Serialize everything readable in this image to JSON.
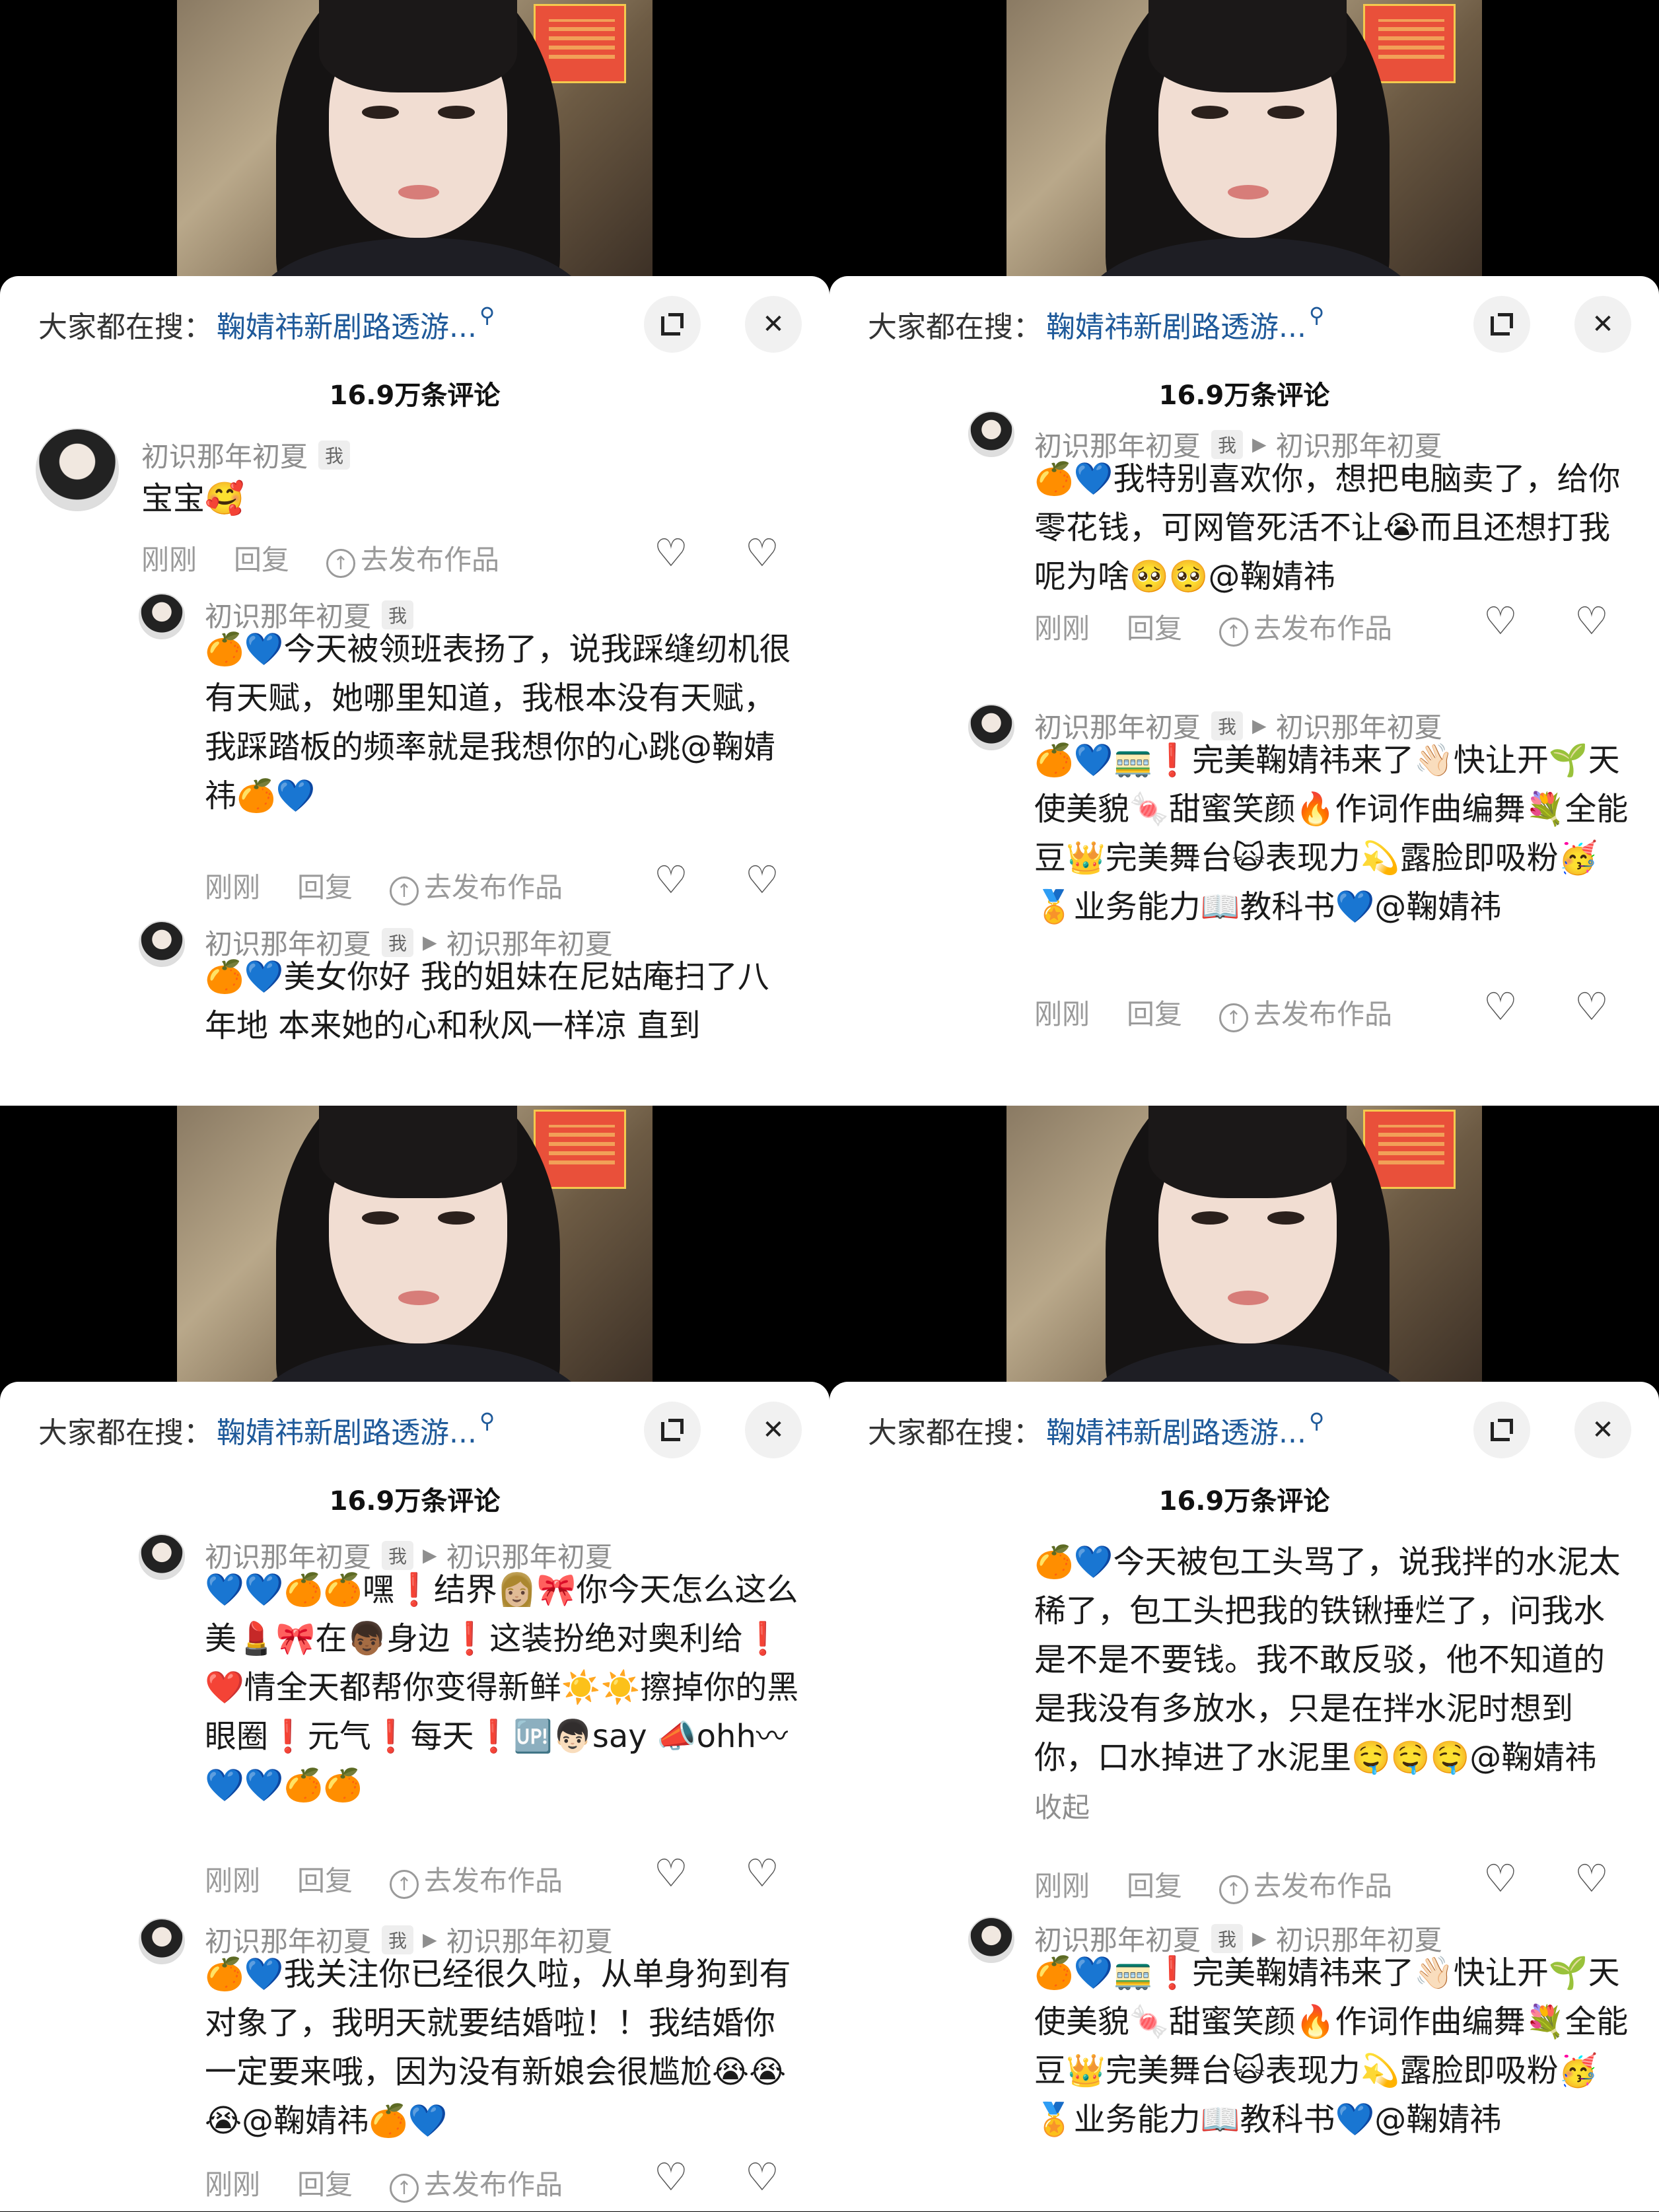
{
  "header": {
    "search_prefix": "大家都在搜：",
    "search_query": "鞠婧祎新剧路透游...",
    "comment_count": "16.9万条评论"
  },
  "icons": {
    "expand": "expand-icon",
    "close": "close-icon",
    "like": "heart-icon",
    "dislike": "broken-heart-icon",
    "upload": "upload-icon"
  },
  "actions": {
    "time": "刚刚",
    "reply": "回复",
    "publish": "去发布作品",
    "collapse": "收起"
  },
  "user": {
    "name": "初识那年初夏",
    "badge": "我",
    "reply_to": "初识那年初夏"
  },
  "quads": [
    {
      "comments": [
        {
          "body": "宝宝🥰"
        },
        {
          "body": "🍊💙今天被领班表扬了，说我踩缝纫机很有天赋，她哪里知道，我根本没有天赋，我踩踏板的频率就是我想你的心跳@鞠婧祎🍊💙"
        },
        {
          "body": "🍊💙美女你好 我的姐妹在尼姑庵扫了八年地 本来她的心和秋风一样凉 直到"
        }
      ]
    },
    {
      "comments": [
        {
          "body": "🍊💙我特别喜欢你，想把电脑卖了，给你零花钱，可网管死活不让😭而且还想打我呢为啥🥺🥺@鞠婧祎"
        },
        {
          "body": "🍊💙🚃❗完美鞠婧祎来了👋🏻快让开🌱天使美貌🍬甜蜜笑颜🔥作词作曲编舞💐全能豆👑完美舞台🙀表现力💫露脸即吸粉🥳🏅业务能力📖教科书💙@鞠婧祎"
        }
      ]
    },
    {
      "comments": [
        {
          "body": "💙💙🍊🍊嘿❗结界👩🏼🎀你今天怎么这么美💄🎀在👦🏾身边❗这装扮绝对奥利给❗❤️情全天都帮你变得新鲜☀️☀️擦掉你的黑眼圈❗元气❗每天❗🆙👦🏻say 📣ohh〰💙💙🍊🍊"
        },
        {
          "body": "🍊💙我关注你已经很久啦，从单身狗到有对象了，我明天就要结婚啦！！我结婚你一定要来哦，因为没有新娘会很尴尬😭😭😭@鞠婧祎🍊💙"
        }
      ]
    },
    {
      "comments": [
        {
          "body": "🍊💙今天被包工头骂了，说我拌的水泥太稀了，包工头把我的铁锹捶烂了，问我水是不是不要钱。我不敢反驳，他不知道的是我没有多放水，只是在拌水泥时想到你，口水掉进了水泥里🤤🤤🤤@鞠婧祎"
        },
        {
          "body": "🍊💙🚃❗完美鞠婧祎来了👋🏻快让开🌱天使美貌🍬甜蜜笑颜🔥作词作曲编舞💐全能豆👑完美舞台🙀表现力💫露脸即吸粉🥳🏅业务能力📖教科书💙@鞠婧祎"
        }
      ]
    }
  ]
}
